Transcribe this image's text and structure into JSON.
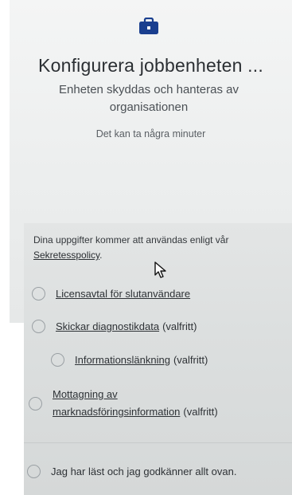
{
  "header": {
    "icon": "briefcase-icon",
    "title": "Konfigurera jobbenheten ...",
    "subtitle": "Enheten skyddas och hanteras av organisationen",
    "wait_text": "Det kan ta några minuter"
  },
  "consent": {
    "text": "Dina uppgifter kommer att användas enligt vår",
    "privacy_link": "Sekretesspolicy",
    "period": "."
  },
  "options": [
    {
      "link": "Licensavtal för slutanvändare",
      "suffix": ""
    },
    {
      "link": "Skickar diagnostikdata",
      "suffix": "(valfritt)"
    },
    {
      "link": "Informationslänkning",
      "suffix": "(valfritt)"
    },
    {
      "link_line1": "Mottagning av",
      "link_line2": "marknadsföringsinformation",
      "suffix": "(valfritt)"
    },
    {
      "label": "Jag har läst och jag godkänner allt ovan."
    }
  ],
  "colors": {
    "accent": "#1a3f8f"
  }
}
